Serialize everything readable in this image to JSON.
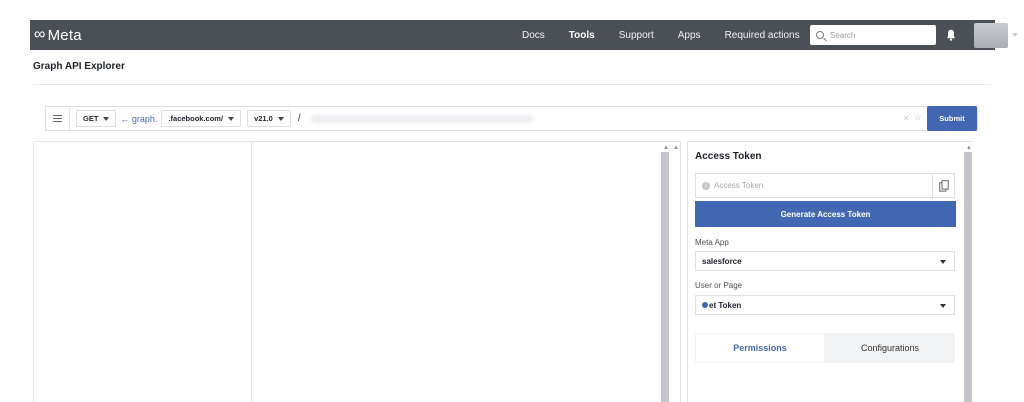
{
  "brand": {
    "name": "Meta",
    "symbol": "∞"
  },
  "nav": {
    "items": [
      "Docs",
      "Tools",
      "Support",
      "Apps",
      "Required actions"
    ],
    "active": "Tools"
  },
  "search": {
    "placeholder": "Search"
  },
  "icons": {
    "bell": "bell-icon",
    "menu": "hamburger-icon",
    "copy": "copy-icon",
    "info": "info-icon",
    "search": "search-icon"
  },
  "page": {
    "title": "Graph API Explorer"
  },
  "query": {
    "method": "GET",
    "arrow_text": "← graph.",
    "host": ".facebook.com/",
    "version": "v21.0",
    "slash": "/",
    "clear": "×",
    "star": "☆",
    "submit": "Submit"
  },
  "access_token": {
    "title": "Access Token",
    "placeholder": "Access Token",
    "generate_label": "Generate Access Token"
  },
  "meta_app": {
    "label": "Meta App",
    "value": "salesforce"
  },
  "user_or_page": {
    "label": "User or Page",
    "value": "et Token"
  },
  "tabs": {
    "permissions": "Permissions",
    "configurations": "Configurations"
  },
  "colors": {
    "topbar": "#4b4f56",
    "accent": "#4267b2"
  }
}
